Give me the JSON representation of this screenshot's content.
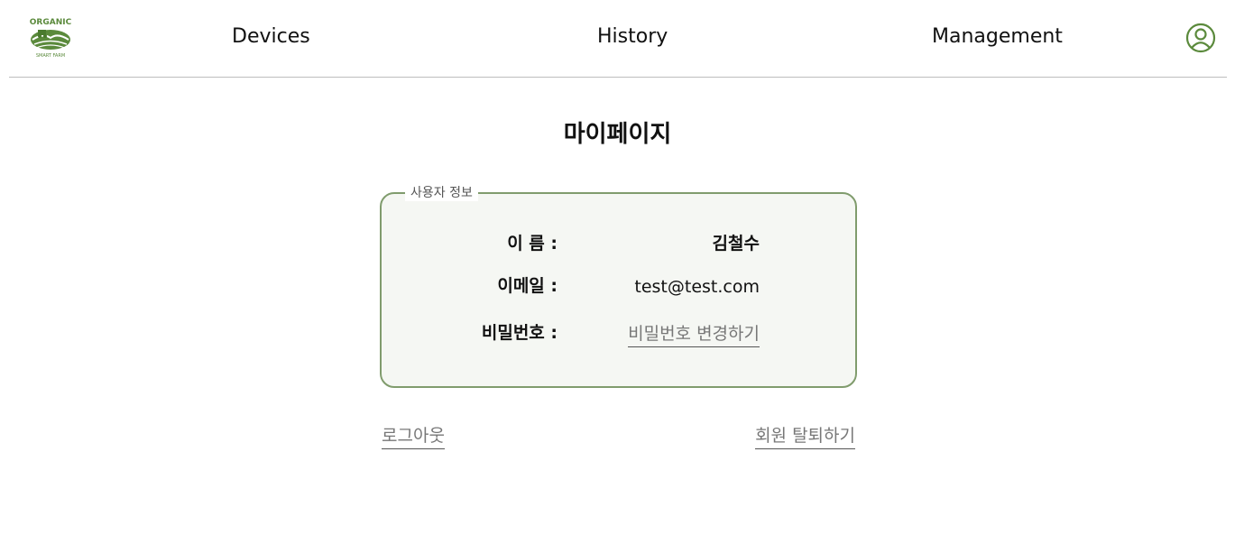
{
  "header": {
    "logo_text": "ORGANIC",
    "logo_subtext": "SMART FARM",
    "nav": [
      "Devices",
      "History",
      "Management"
    ],
    "profile_icon": "user-circle-icon"
  },
  "page": {
    "title": "마이페이지"
  },
  "user_info": {
    "legend": "사용자 정보",
    "name_label": "이 름 :",
    "name_value": "김철수",
    "email_label": "이메일 :",
    "email_value": "test@test.com",
    "password_label": "비밀번호 :",
    "password_link": "비밀번호 변경하기"
  },
  "actions": {
    "logout": "로그아웃",
    "withdraw": "회원 탈퇴하기"
  },
  "colors": {
    "accent": "#809c6d",
    "logo_green": "#5b8a3c",
    "box_bg": "#f5f7f3"
  }
}
